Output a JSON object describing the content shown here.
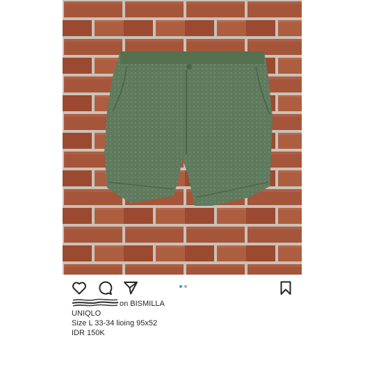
{
  "post": {
    "image_alt": "green shorts on brick wall",
    "carousel": {
      "dot_count": 2,
      "active_index": 0,
      "active_color": "#3897f0",
      "inactive_color": "#a8a8a8"
    },
    "actions": {
      "like_icon": "heart-icon",
      "comment_icon": "comment-icon",
      "share_icon": "send-icon",
      "save_icon": "bookmark-icon"
    },
    "caption": {
      "first_line_visible": "on BISMILLA",
      "lines": [
        "UNIQLO",
        "Size L 33-34 lioing 95x52",
        "IDR 150K"
      ]
    }
  }
}
